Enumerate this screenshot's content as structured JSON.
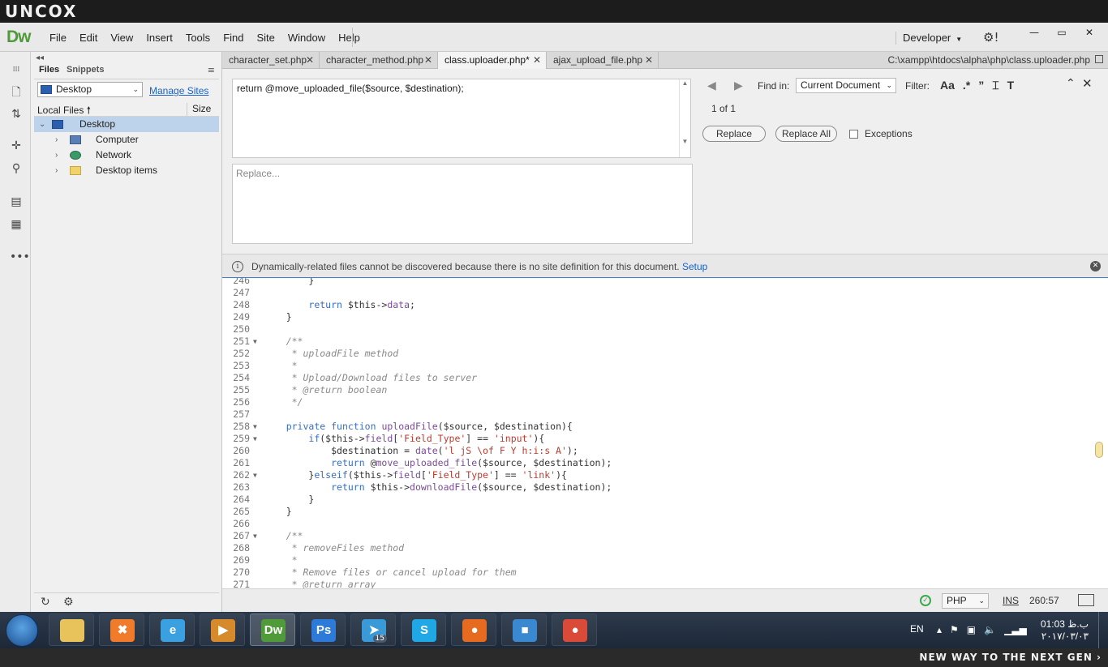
{
  "brand": "UNCOX",
  "slogan": "NEW WAY TO THE NEXT GEN ›",
  "app": {
    "logo": "Dw",
    "menus": [
      "File",
      "Edit",
      "View",
      "Insert",
      "Tools",
      "Find",
      "Site",
      "Window",
      "Help"
    ],
    "workspace": "Developer"
  },
  "files_panel": {
    "tabs": [
      "Files",
      "Snippets"
    ],
    "site": "Desktop",
    "manage_sites": "Manage Sites",
    "col_local": "Local Files",
    "col_size": "Size",
    "tree": [
      {
        "label": "Desktop",
        "selected": true,
        "icon": "desktop-icon"
      },
      {
        "label": "Computer",
        "selected": false,
        "icon": "computer-icon"
      },
      {
        "label": "Network",
        "selected": false,
        "icon": "network-icon"
      },
      {
        "label": "Desktop items",
        "selected": false,
        "icon": "folder-icon"
      }
    ]
  },
  "doc_tabs": [
    {
      "label": "character_set.php",
      "active": false
    },
    {
      "label": "character_method.php",
      "active": false
    },
    {
      "label": "class.uploader.php*",
      "active": true
    },
    {
      "label": "ajax_upload_file.php",
      "active": false
    }
  ],
  "doc_path": "C:\\xampp\\htdocs\\alpha\\php\\class.uploader.php",
  "find": {
    "find_text": "return @move_uploaded_file($source, $destination);",
    "replace_placeholder": "Replace...",
    "find_in_label": "Find in:",
    "find_in_value": "Current Document",
    "filter_label": "Filter:",
    "filter_icons": [
      "Aa",
      ".*",
      "”",
      "⌶",
      "T"
    ],
    "match_count": "1 of 1",
    "replace_btn": "Replace",
    "replace_all_btn": "Replace All",
    "exceptions_label": "Exceptions"
  },
  "infobar": {
    "text": "Dynamically-related files cannot be discovered because there is no site definition for this document.",
    "link": "Setup"
  },
  "code": [
    {
      "n": "246",
      "fold": false,
      "text": "        }"
    },
    {
      "n": "247",
      "fold": false,
      "text": ""
    },
    {
      "n": "248",
      "fold": false,
      "text": "        return $this->data;"
    },
    {
      "n": "249",
      "fold": false,
      "text": "    }"
    },
    {
      "n": "250",
      "fold": false,
      "text": ""
    },
    {
      "n": "251",
      "fold": true,
      "text": "    /**"
    },
    {
      "n": "252",
      "fold": false,
      "text": "     * uploadFile method"
    },
    {
      "n": "253",
      "fold": false,
      "text": "     *"
    },
    {
      "n": "254",
      "fold": false,
      "text": "     * Upload/Download files to server"
    },
    {
      "n": "255",
      "fold": false,
      "text": "     * @return boolean"
    },
    {
      "n": "256",
      "fold": false,
      "text": "     */"
    },
    {
      "n": "257",
      "fold": false,
      "text": ""
    },
    {
      "n": "258",
      "fold": true,
      "text": "    private function uploadFile($source, $destination){"
    },
    {
      "n": "259",
      "fold": true,
      "text": "        if($this->field['Field_Type'] == 'input'){"
    },
    {
      "n": "260",
      "fold": false,
      "text": "            $destination = date('l jS \\of F Y h:i:s A');"
    },
    {
      "n": "261",
      "fold": false,
      "text": "            return @move_uploaded_file($source, $destination);"
    },
    {
      "n": "262",
      "fold": true,
      "text": "        }elseif($this->field['Field_Type'] == 'link'){"
    },
    {
      "n": "263",
      "fold": false,
      "text": "            return $this->downloadFile($source, $destination);"
    },
    {
      "n": "264",
      "fold": false,
      "text": "        }"
    },
    {
      "n": "265",
      "fold": false,
      "text": "    }"
    },
    {
      "n": "266",
      "fold": false,
      "text": ""
    },
    {
      "n": "267",
      "fold": true,
      "text": "    /**"
    },
    {
      "n": "268",
      "fold": false,
      "text": "     * removeFiles method"
    },
    {
      "n": "269",
      "fold": false,
      "text": "     *"
    },
    {
      "n": "270",
      "fold": false,
      "text": "     * Remove files or cancel upload for them"
    },
    {
      "n": "271",
      "fold": false,
      "text": "     * @return array"
    }
  ],
  "status": {
    "language": "PHP",
    "mode": "INS",
    "cursor": "260:57"
  },
  "taskbar": {
    "apps": [
      {
        "name": "explorer-app",
        "glyph": "",
        "color": "#e8c25a",
        "active": false
      },
      {
        "name": "xampp-app",
        "glyph": "✖",
        "color": "#f07b2a",
        "active": false
      },
      {
        "name": "ie-app",
        "glyph": "e",
        "color": "#3aa0e0",
        "active": false
      },
      {
        "name": "media-app",
        "glyph": "▶",
        "color": "#d78a2c",
        "active": false
      },
      {
        "name": "dreamweaver-app",
        "glyph": "Dw",
        "color": "#4f9b39",
        "active": true
      },
      {
        "name": "photoshop-app",
        "glyph": "Ps",
        "color": "#2d7ad8",
        "active": false
      },
      {
        "name": "telegram-app",
        "glyph": "➤",
        "color": "#3a9ad8",
        "active": false,
        "badge": "15"
      },
      {
        "name": "skype-app",
        "glyph": "S",
        "color": "#1fa7e6",
        "active": false
      },
      {
        "name": "firefox-app",
        "glyph": "●",
        "color": "#e66a1f",
        "active": false
      },
      {
        "name": "box-app",
        "glyph": "■",
        "color": "#3a88d0",
        "active": false
      },
      {
        "name": "chrome-app",
        "glyph": "●",
        "color": "#d94a38",
        "active": false
      }
    ],
    "lang": "EN",
    "time": "01:03 ب.ظ",
    "date": "۲۰۱۷/۰۳/۰۳"
  }
}
